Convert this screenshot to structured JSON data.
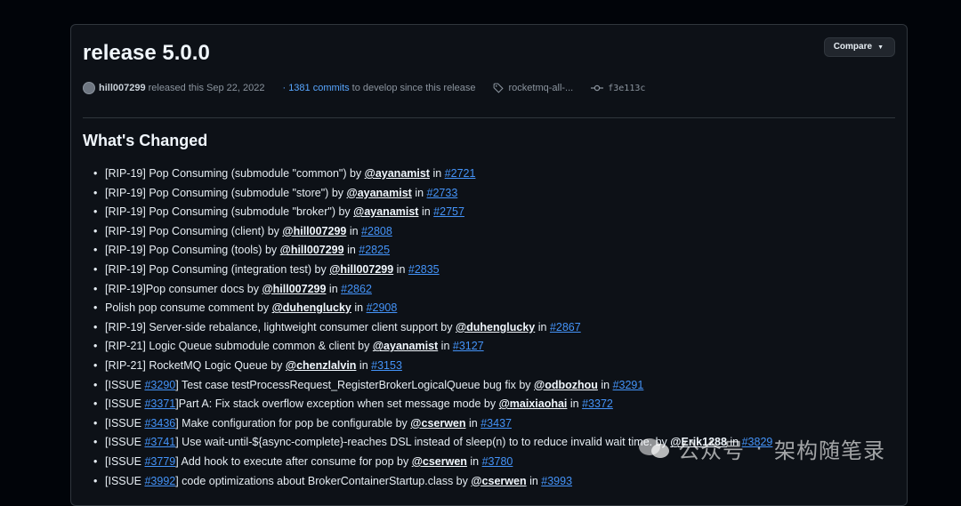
{
  "release": {
    "title": "release 5.0.0",
    "compare_label": "Compare",
    "author": "hill007299",
    "released_text": "released this Sep 22, 2022",
    "commits_link": "· 1381 commits",
    "commits_tail": "to develop since this release",
    "tag": "rocketmq-all-...",
    "commit": "f3e113c"
  },
  "section_title": "What's Changed",
  "changes": [
    {
      "pre": "[RIP-19] Pop Consuming (submodule \"common\") by ",
      "user": "@ayanamist",
      "mid": " in ",
      "pr": "#2721"
    },
    {
      "pre": "[RIP-19] Pop Consuming (submodule \"store\") by ",
      "user": "@ayanamist",
      "mid": " in ",
      "pr": "#2733"
    },
    {
      "pre": "[RIP-19] Pop Consuming (submodule \"broker\") by ",
      "user": "@ayanamist",
      "mid": " in ",
      "pr": "#2757"
    },
    {
      "pre": "[RIP-19] Pop Consuming (client) by ",
      "user": "@hill007299",
      "mid": " in ",
      "pr": "#2808"
    },
    {
      "pre": "[RIP-19] Pop Consuming (tools) by ",
      "user": "@hill007299",
      "mid": " in ",
      "pr": "#2825"
    },
    {
      "pre": "[RIP-19] Pop Consuming (integration test) by ",
      "user": "@hill007299",
      "mid": " in ",
      "pr": "#2835"
    },
    {
      "pre": "[RIP-19]Pop consumer docs by ",
      "user": "@hill007299",
      "mid": " in ",
      "pr": "#2862"
    },
    {
      "pre": "Polish pop consume comment by ",
      "user": "@duhenglucky",
      "mid": " in ",
      "pr": "#2908"
    },
    {
      "pre": "[RIP-19] Server-side rebalance, lightweight consumer client support by ",
      "user": "@duhenglucky",
      "mid": " in ",
      "pr": "#2867"
    },
    {
      "pre": "[RIP-21] Logic Queue submodule common & client by ",
      "user": "@ayanamist",
      "mid": " in ",
      "pr": "#3127"
    },
    {
      "pre": "[RIP-21] RocketMQ Logic Queue by ",
      "user": "@chenzlalvin",
      "mid": " in ",
      "pr": "#3153"
    },
    {
      "issue_pre": "[ISSUE ",
      "issue": "#3290",
      "pre": "] Test case testProcessRequest_RegisterBrokerLogicalQueue bug fix by ",
      "user": "@odbozhou",
      "mid": " in ",
      "pr": "#3291"
    },
    {
      "issue_pre": "[ISSUE ",
      "issue": "#3371",
      "pre": "]Part A: Fix stack overflow exception when set message mode by ",
      "user": "@maixiaohai",
      "mid": " in ",
      "pr": "#3372"
    },
    {
      "issue_pre": "[ISSUE ",
      "issue": "#3436",
      "pre": "] Make configuration for pop be configurable by ",
      "user": "@cserwen",
      "mid": " in ",
      "pr": "#3437"
    },
    {
      "issue_pre": "[ISSUE ",
      "issue": "#3741",
      "pre": "] Use wait-until-${async-complete}-reaches DSL instead of sleep(n) to to reduce invalid wait time. by ",
      "user": "@Erik1288",
      "mid": " in ",
      "pr": "#3829"
    },
    {
      "issue_pre": "[ISSUE ",
      "issue": "#3779",
      "pre": "] Add hook to execute after consume for pop by ",
      "user": "@cserwen",
      "mid": " in ",
      "pr": "#3780"
    },
    {
      "issue_pre": "[ISSUE ",
      "issue": "#3992",
      "pre": "] code optimizations about BrokerContainerStartup.class by ",
      "user": "@cserwen",
      "mid": " in ",
      "pr": "#3993"
    }
  ],
  "watermark": {
    "left": "公众号",
    "sep": "·",
    "right": "架构随笔录"
  },
  "colors": {
    "background": "#0d1117",
    "link": "#4493f8",
    "muted": "#8b949e",
    "border": "#30363d"
  }
}
